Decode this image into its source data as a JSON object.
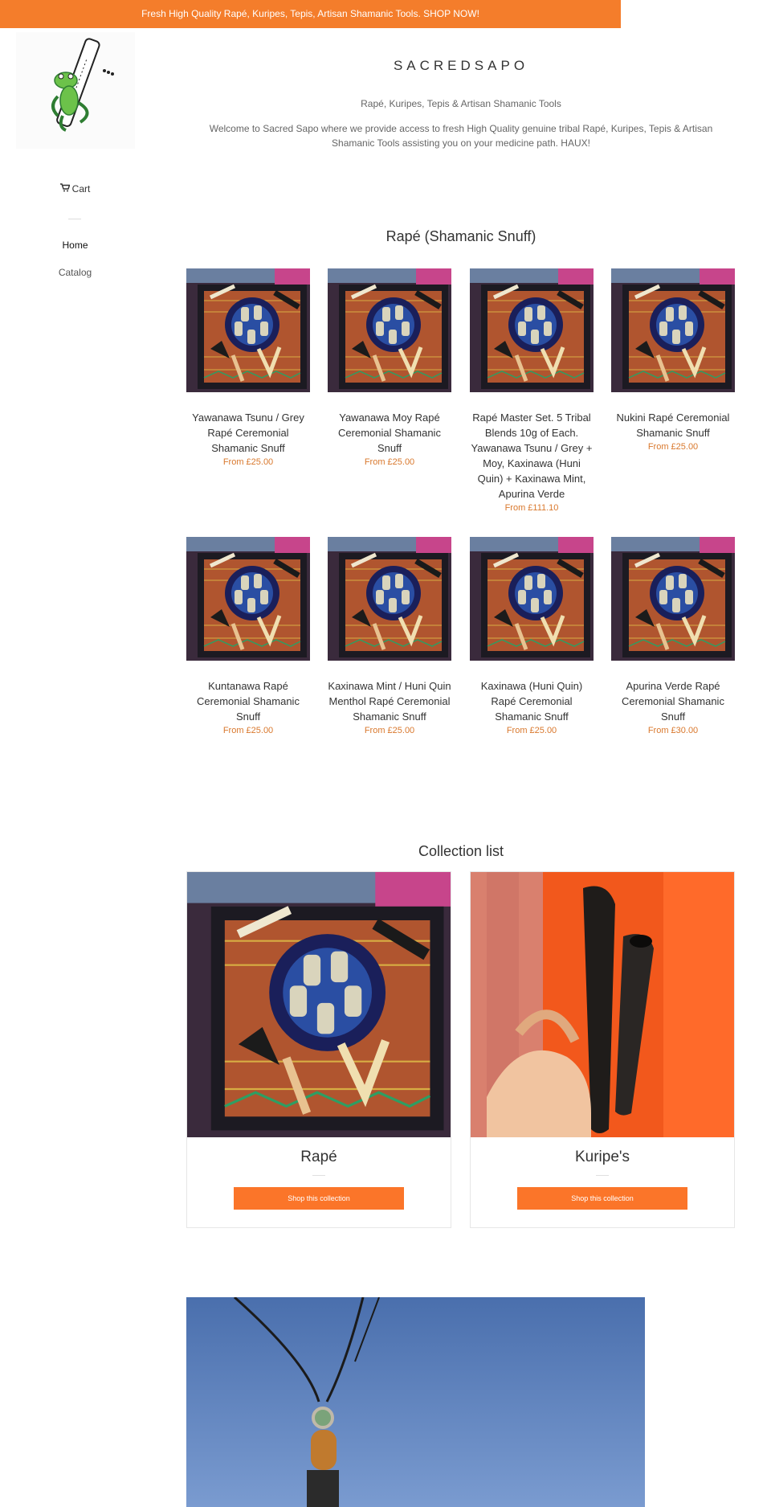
{
  "announcement": "Fresh High Quality Rapé, Kuripes, Tepis, Artisan Shamanic Tools. SHOP NOW!",
  "sidebar": {
    "cart_label": "Cart",
    "cart_icon": "cart-icon",
    "nav": [
      {
        "label": "Home"
      },
      {
        "label": "Catalog"
      }
    ]
  },
  "header": {
    "title": "SACREDSAPO",
    "tagline": "Rapé, Kuripes, Tepis & Artisan Shamanic Tools",
    "welcome": "Welcome to Sacred Sapo where we provide access to fresh High Quality genuine tribal Rapé, Kuripes, Tepis & Artisan Shamanic Tools assisting you on your medicine path. HAUX!"
  },
  "featured_collection": {
    "title": "Rapé (Shamanic Snuff)",
    "products": [
      {
        "name": "Yawanawa Tsunu / Grey Rapé Ceremonial Shamanic Snuff",
        "price": "From £25.00"
      },
      {
        "name": "Yawanawa Moy Rapé Ceremonial Shamanic Snuff",
        "price": "From £25.00"
      },
      {
        "name": "Rapé Master Set. 5 Tribal Blends 10g of Each. Yawanawa Tsunu / Grey + Moy, Kaxinawa (Huni Quin) + Kaxinawa Mint, Apurina Verde",
        "price": "From £111.10"
      },
      {
        "name": "Nukini Rapé Ceremonial Shamanic Snuff",
        "price": "From £25.00"
      },
      {
        "name": "Kuntanawa Rapé Ceremonial Shamanic Snuff",
        "price": "From £25.00"
      },
      {
        "name": "Kaxinawa Mint / Huni Quin Menthol Rapé Ceremonial Shamanic Snuff",
        "price": "From £25.00"
      },
      {
        "name": "Kaxinawa (Huni Quin) Rapé Ceremonial Shamanic Snuff",
        "price": "From £25.00"
      },
      {
        "name": "Apurina Verde Rapé Ceremonial Shamanic Snuff",
        "price": "From £30.00"
      }
    ]
  },
  "collection_list": {
    "title": "Collection list",
    "items": [
      {
        "title": "Rapé",
        "button": "Shop this collection"
      },
      {
        "title": "Kuripe's",
        "button": "Shop this collection"
      }
    ]
  },
  "colors": {
    "accent": "#f47d2b",
    "price": "#d9782d",
    "button": "#fb7529"
  }
}
